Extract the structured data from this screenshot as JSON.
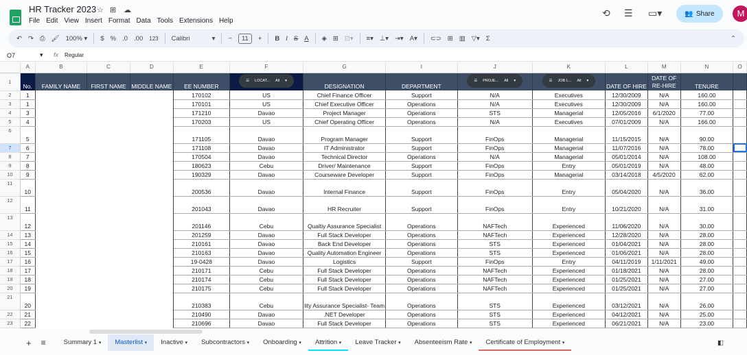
{
  "app": {
    "title": "HR Tracker 2023",
    "menu": [
      "File",
      "Edit",
      "View",
      "Insert",
      "Format",
      "Data",
      "Tools",
      "Extensions",
      "Help"
    ],
    "share_label": "Share",
    "avatar_initial": "M"
  },
  "toolbar": {
    "zoom": "100%",
    "currency": "$",
    "percent": "%",
    "dec_dec": ".0",
    "inc_dec": ".00",
    "format_123": "123",
    "font": "Calibri",
    "font_size": "11"
  },
  "formula_bar": {
    "cell_ref": "O7",
    "fx": "fx",
    "value": "Regular"
  },
  "columns": [
    "A",
    "B",
    "C",
    "D",
    "E",
    "F",
    "G",
    "I",
    "J",
    "K",
    "L",
    "M",
    "N"
  ],
  "headers": [
    "No.",
    "FAMILY NAME",
    "FIRST NAME",
    "MIDDLE NAME",
    "EE NUMBER",
    "",
    "DESIGNATION",
    "DEPARTMENT",
    "",
    "",
    "DATE OF HIRE",
    "DATE OF RE-HIRE",
    "TENURE"
  ],
  "filter_chips": {
    "location": "LOCAT...",
    "project": "PROJE...",
    "job_level": "JOB L...",
    "all": "All"
  },
  "rows": [
    {
      "r": 2,
      "no": "1",
      "ee": "170102",
      "loc": "US",
      "des": "Chief Finance Officer",
      "dep": "Support",
      "proj": "N/A",
      "job": "Executives",
      "hire": "12/30/2009",
      "rehire": "N/A",
      "ten": "160.00"
    },
    {
      "r": 3,
      "no": "1",
      "ee": "170101",
      "loc": "US",
      "des": "Chief Executive Officer",
      "dep": "Operations",
      "proj": "N/A",
      "job": "Executives",
      "hire": "12/30/2009",
      "rehire": "N/A",
      "ten": "160.00"
    },
    {
      "r": 4,
      "no": "3",
      "ee": "171210",
      "loc": "Davao",
      "des": "Project Manager",
      "dep": "Operations",
      "proj": "STS",
      "job": "Managerial",
      "hire": "12/05/2016",
      "rehire": "6/1/2020",
      "ten": "77.00"
    },
    {
      "r": 5,
      "no": "4",
      "ee": "170203",
      "loc": "US",
      "des": "Chief Operating Officer",
      "dep": "Operations",
      "proj": "N/A",
      "job": "Executives",
      "hire": "07/01/2009",
      "rehire": "N/A",
      "ten": "166.00"
    },
    {
      "r": 6,
      "no": "5",
      "ee": "171105",
      "loc": "Davao",
      "des": "Program Manager",
      "dep": "Support",
      "proj": "FinOps",
      "job": "Managerial",
      "hire": "11/15/2015",
      "rehire": "N/A",
      "ten": "90.00",
      "tall": true
    },
    {
      "r": 7,
      "no": "6",
      "ee": "171108",
      "loc": "Davao",
      "des": "IT Administrator",
      "dep": "Support",
      "proj": "FinOps",
      "job": "Managerial",
      "hire": "11/07/2016",
      "rehire": "N/A",
      "ten": "78.00"
    },
    {
      "r": 8,
      "no": "7",
      "ee": "170504",
      "loc": "Davao",
      "des": "Technical Director",
      "dep": "Operations",
      "proj": "N/A",
      "job": "Managerial",
      "hire": "05/01/2014",
      "rehire": "N/A",
      "ten": "108.00"
    },
    {
      "r": 9,
      "no": "8",
      "ee": "180623",
      "loc": "Cebu",
      "des": "Driver/ Maintenance",
      "dep": "Support",
      "proj": "FinOps",
      "job": "Entry",
      "hire": "05/01/2019",
      "rehire": "N/A",
      "ten": "48.00"
    },
    {
      "r": 10,
      "no": "9",
      "ee": "190329",
      "loc": "Davao",
      "des": "Courseware Developer",
      "dep": "Support",
      "proj": "FinOps",
      "job": "Managerial",
      "hire": "03/14/2018",
      "rehire": "4/5/2020",
      "ten": "62.00"
    },
    {
      "r": 11,
      "no": "10",
      "ee": "200536",
      "loc": "Davao",
      "des": "Internal Finance",
      "dep": "Support",
      "proj": "FinOps",
      "job": "Entry",
      "hire": "05/04/2020",
      "rehire": "N/A",
      "ten": "36.00",
      "tall": true
    },
    {
      "r": 12,
      "no": "11",
      "ee": "201043",
      "loc": "Davao",
      "des": "HR Recruiter",
      "dep": "Support",
      "proj": "FinOps",
      "job": "Entry",
      "hire": "10/21/2020",
      "rehire": "N/A",
      "ten": "31.00",
      "tall": true
    },
    {
      "r": 13,
      "no": "12",
      "ee": "201146",
      "loc": "Cebu",
      "des": "Qualtiy Assurance Specialist",
      "dep": "Operations",
      "proj": "NAFTech",
      "job": "Experienced",
      "hire": "11/06/2020",
      "rehire": "N/A",
      "ten": "30.00",
      "tall": true
    },
    {
      "r": 14,
      "no": "13",
      "ee": "201259",
      "loc": "Davao",
      "des": "Full Stack Developer",
      "dep": "Operations",
      "proj": "NAFTech",
      "job": "Experienced",
      "hire": "12/28/2020",
      "rehire": "N/A",
      "ten": "28.00"
    },
    {
      "r": 15,
      "no": "14",
      "ee": "210161",
      "loc": "Davao",
      "des": "Back End Developer",
      "dep": "Operations",
      "proj": "STS",
      "job": "Experienced",
      "hire": "01/04/2021",
      "rehire": "N/A",
      "ten": "28.00"
    },
    {
      "r": 16,
      "no": "15",
      "ee": "210163",
      "loc": "Davao",
      "des": "Quality Automation Engineer",
      "dep": "Operations",
      "proj": "STS",
      "job": "Experienced",
      "hire": "01/06/2021",
      "rehire": "N/A",
      "ten": "28.00"
    },
    {
      "r": 17,
      "no": "16",
      "ee": "19-0428",
      "loc": "Davao",
      "des": "Logistics",
      "dep": "Support",
      "proj": "FinOps",
      "job": "Entry",
      "hire": "04/11/2019",
      "rehire": "1/11/2021",
      "ten": "49.00"
    },
    {
      "r": 18,
      "no": "17",
      "ee": "210171",
      "loc": "Cebu",
      "des": "Full Stack Developer",
      "dep": "Operations",
      "proj": "NAFTech",
      "job": "Experienced",
      "hire": "01/18/2021",
      "rehire": "N/A",
      "ten": "28.00"
    },
    {
      "r": 19,
      "no": "18",
      "ee": "210174",
      "loc": "Cebu",
      "des": "Full Stack Developer",
      "dep": "Operations",
      "proj": "NAFTech",
      "job": "Experienced",
      "hire": "01/25/2021",
      "rehire": "N/A",
      "ten": "27.00"
    },
    {
      "r": 20,
      "no": "19",
      "ee": "210175",
      "loc": "Cebu",
      "des": "Full Stack Developer",
      "dep": "Operations",
      "proj": "NAFTech",
      "job": "Experienced",
      "hire": "01/25/2021",
      "rehire": "N/A",
      "ten": "27.00"
    },
    {
      "r": 21,
      "no": "20",
      "ee": "210383",
      "loc": "Cebu",
      "des": "lity Assurance Specialist- Team",
      "dep": "Operations",
      "proj": "STS",
      "job": "Experienced",
      "hire": "03/12/2021",
      "rehire": "N/A",
      "ten": "26.00",
      "tall": true
    },
    {
      "r": 22,
      "no": "21",
      "ee": "210490",
      "loc": "Davao",
      "des": ".NET Developer",
      "dep": "Operations",
      "proj": "STS",
      "job": "Experienced",
      "hire": "04/12/2021",
      "rehire": "N/A",
      "ten": "25.00"
    },
    {
      "r": 23,
      "no": "22",
      "ee": "210696",
      "loc": "Davao",
      "des": "Full Stack Developer",
      "dep": "Operations",
      "proj": "STS",
      "job": "Experienced",
      "hire": "06/21/2021",
      "rehire": "N/A",
      "ten": "23.00"
    }
  ],
  "sheet_tabs": [
    "Summary 1",
    "Masterlist",
    "Inactive",
    "Subcontractors",
    "Onboarding",
    "Attrition",
    "Leave Tracker",
    "Absenteeism Rate",
    "Certificate of Employment"
  ],
  "active_tab": "Masterlist",
  "tab_colors": {
    "Attrition": "#00e5ff",
    "Certificate of Employment": "#e06666"
  }
}
